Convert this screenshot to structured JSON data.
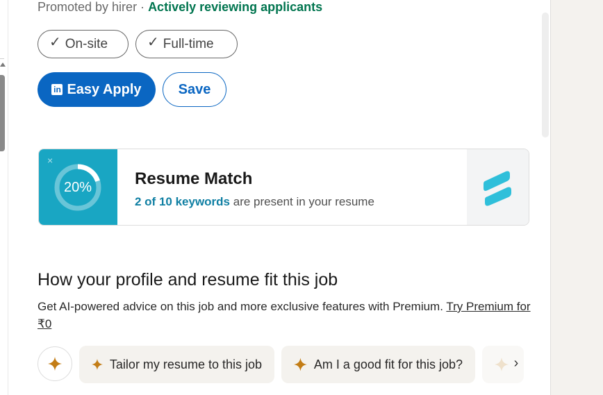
{
  "job": {
    "promoted_text": "Promoted by hirer · ",
    "status_text": "Actively reviewing applicants",
    "tags": [
      "On-site",
      "Full-time"
    ]
  },
  "actions": {
    "apply_label": "Easy Apply",
    "apply_logo_text": "in",
    "save_label": "Save"
  },
  "resume_match": {
    "percent_text": "20%",
    "percent_value": 0.2,
    "title": "Resume Match",
    "keywords_text": "2 of 10 keywords",
    "rest_text": " are present in your resume",
    "close_glyph": "×"
  },
  "fit": {
    "title": "How your profile and resume fit this job",
    "description": "Get AI-powered advice on this job and more exclusive features with Premium. ",
    "try_link": "Try Premium for ₹0"
  },
  "chips": [
    {
      "label": "Tailor my resume to this job"
    },
    {
      "label": "Am I a good fit for this job?"
    }
  ],
  "next_glyph": "›",
  "colors": {
    "brand_blue": "#0a66c2",
    "match_teal": "#19a6c3",
    "status_green": "#01754f",
    "spark_gold": "#c37d16"
  }
}
